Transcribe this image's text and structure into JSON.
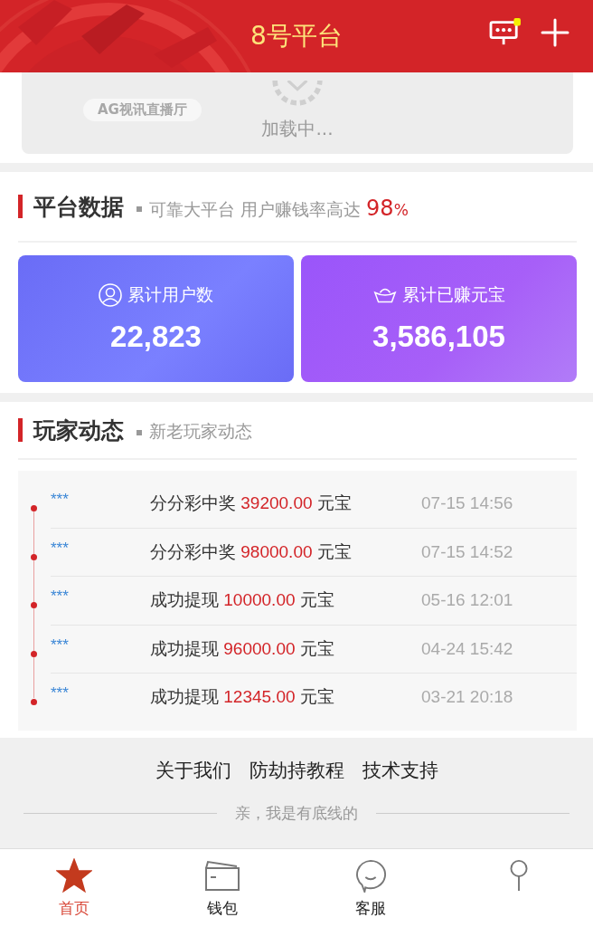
{
  "header": {
    "title": "8号平台",
    "message_badge": true
  },
  "loading": {
    "hall_label": "AG视讯直播厅",
    "status": "加载中..."
  },
  "platform_stats": {
    "title": "平台数据",
    "subtitle": "可靠大平台 用户赚钱率高达",
    "rate": "98",
    "rate_unit": "%",
    "cards": [
      {
        "kind": "users",
        "label": "累计用户数",
        "value": "22,823"
      },
      {
        "kind": "earned",
        "label": "累计已赚元宝",
        "value": "3,586,105"
      }
    ]
  },
  "player_feed": {
    "title": "玩家动态",
    "subtitle": "新老玩家动态",
    "items": [
      {
        "user": "***",
        "event": "分分彩中奖",
        "amount": "39200.00",
        "unit": "元宝",
        "time": "07-15 14:56"
      },
      {
        "user": "***",
        "event": "分分彩中奖",
        "amount": "98000.00",
        "unit": "元宝",
        "time": "07-15 14:52"
      },
      {
        "user": "***",
        "event": "成功提现",
        "amount": "10000.00",
        "unit": "元宝",
        "time": "05-16 12:01"
      },
      {
        "user": "***",
        "event": "成功提现",
        "amount": "96000.00",
        "unit": "元宝",
        "time": "04-24 15:42"
      },
      {
        "user": "***",
        "event": "成功提现",
        "amount": "12345.00",
        "unit": "元宝",
        "time": "03-21 20:18"
      }
    ]
  },
  "footer": {
    "links": [
      "关于我们",
      "防劫持教程",
      "技术支持"
    ],
    "tagline": "亲，我是有底线的"
  },
  "tab_bar": [
    {
      "kind": "home",
      "label": "首页",
      "selected": true
    },
    {
      "kind": "wallet",
      "label": "钱包",
      "selected": false
    },
    {
      "kind": "service",
      "label": "客服",
      "selected": false
    },
    {
      "kind": "profile",
      "selected": false
    }
  ]
}
